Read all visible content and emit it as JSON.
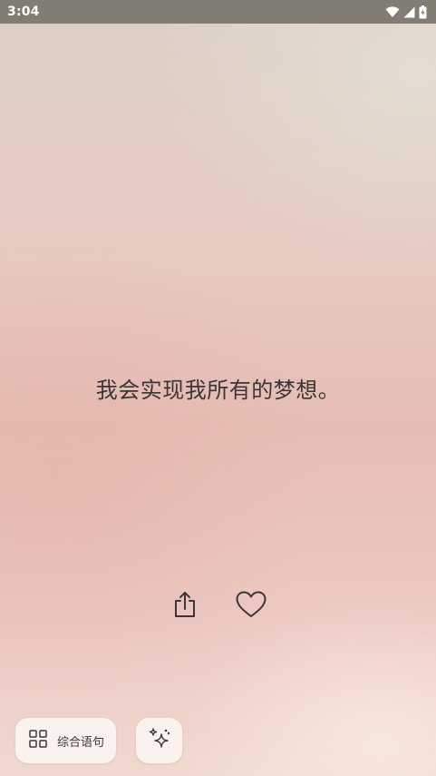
{
  "status_bar": {
    "time": "3:04",
    "icons": [
      "wifi-icon",
      "cell-signal-icon",
      "battery-icon"
    ]
  },
  "quote": {
    "text": "我会实现我所有的梦想。"
  },
  "actions": {
    "share_icon": "share-icon",
    "like_icon": "heart-icon"
  },
  "bottom_bar": {
    "category_label": "综合语句",
    "category_icon": "grid-icon",
    "sparkle_icon": "sparkle-icon"
  },
  "colors": {
    "text": "#3a3638",
    "status_bar_bg": "#78746c",
    "button_bg": "#faf6f4"
  }
}
